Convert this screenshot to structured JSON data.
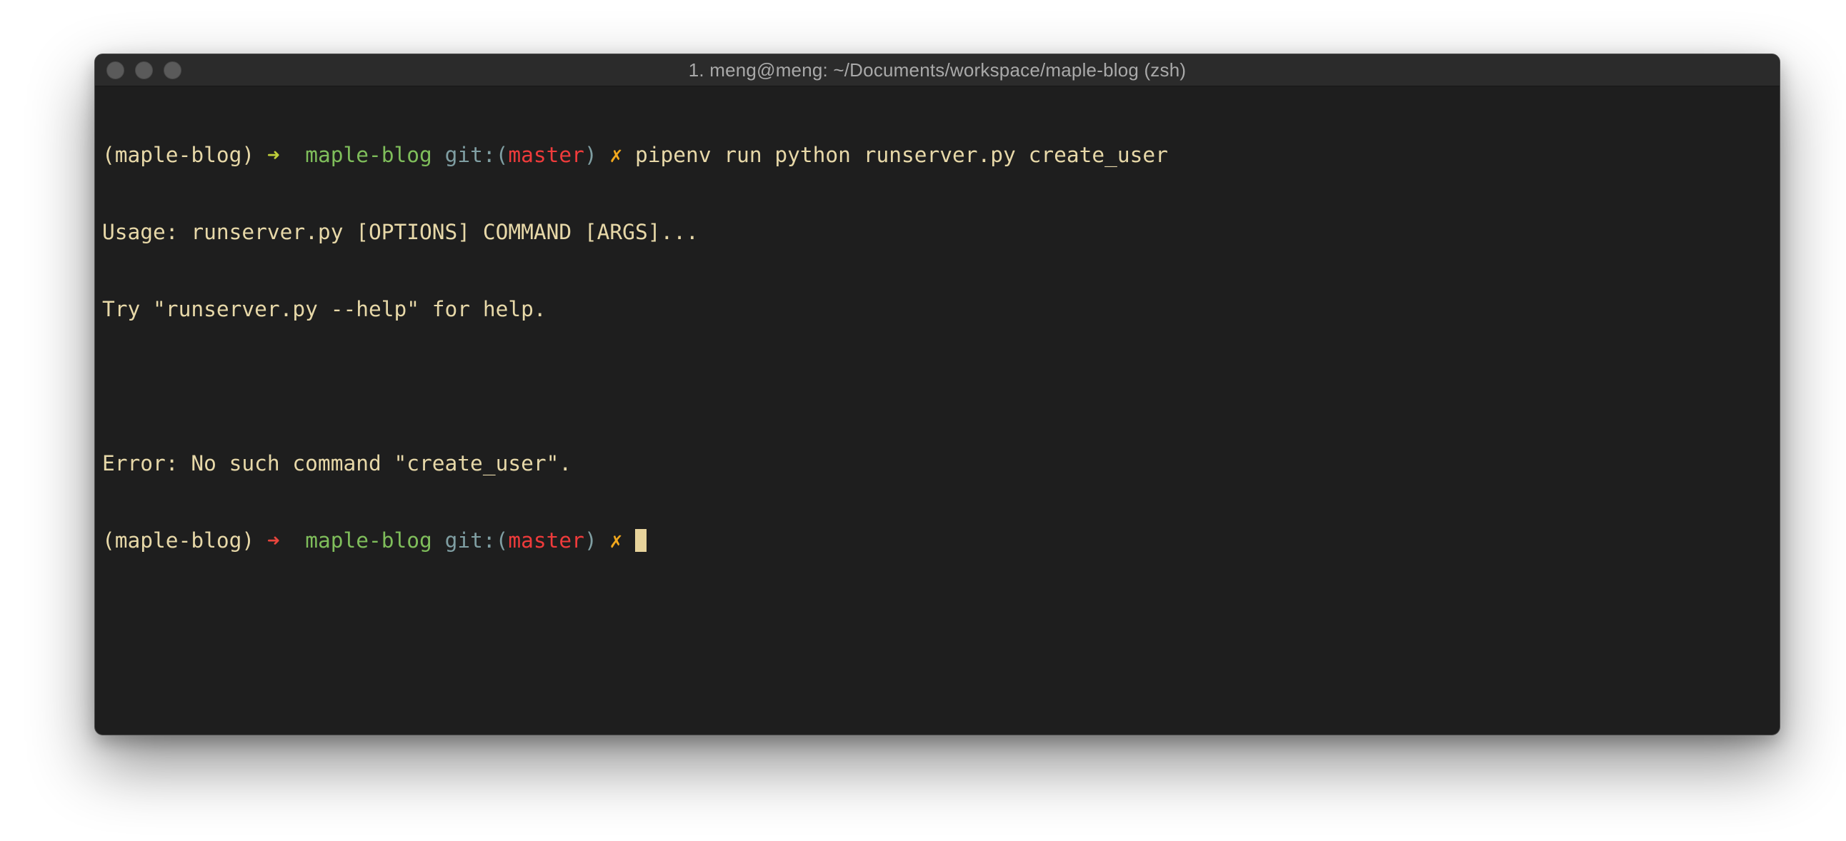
{
  "window": {
    "title": "1. meng@meng: ~/Documents/workspace/maple-blog (zsh)"
  },
  "terminal": {
    "prompt1": {
      "venv": "(maple-blog) ",
      "arrow": "➜",
      "dir": "maple-blog",
      "git_prefix": "git:(",
      "branch": "master",
      "git_suffix": ")",
      "dirty": "✗",
      "command": "pipenv run python runserver.py create_user"
    },
    "output": [
      "Usage: runserver.py [OPTIONS] COMMAND [ARGS]...",
      "Try \"runserver.py --help\" for help.",
      "",
      "Error: No such command \"create_user\"."
    ],
    "prompt2": {
      "venv": "(maple-blog) ",
      "arrow": "➜",
      "dir": "maple-blog",
      "git_prefix": "git:(",
      "branch": "master",
      "git_suffix": ")",
      "dirty": "✗",
      "command": ""
    }
  },
  "colors": {
    "background": "#1e1e1e",
    "text": "#e7d8a8",
    "arrow_success": "#bfcf3a",
    "arrow_error": "#e8453c",
    "directory": "#7fbe5b",
    "git_label": "#7f9ea2",
    "branch": "#ef3b3b",
    "dirty_marker": "#f2a81d"
  }
}
